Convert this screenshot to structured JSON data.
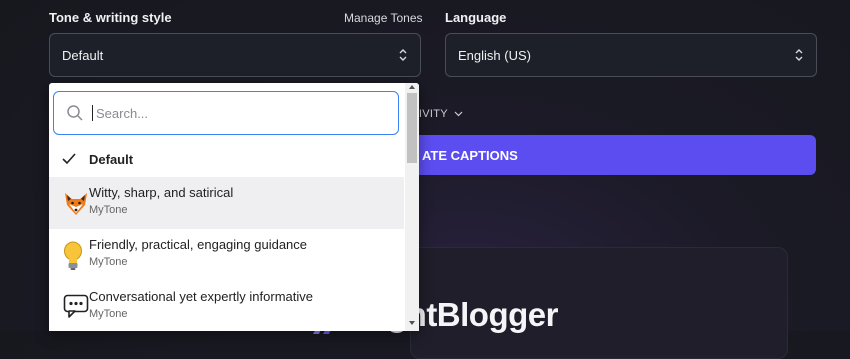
{
  "tone": {
    "label": "Tone & writing style",
    "manage_link": "Manage Tones",
    "selected": "Default"
  },
  "language": {
    "label": "Language",
    "selected": "English (US)"
  },
  "activity_label": "ATIVITY",
  "generate_button": "ATE CAPTIONS",
  "brand_text": "RightBlogger",
  "dropdown": {
    "search_placeholder": "Search...",
    "options": [
      {
        "title": "Default",
        "checked": true
      },
      {
        "title": "Witty, sharp, and satirical",
        "subtitle": "MyTone",
        "icon": "fox-icon"
      },
      {
        "title": "Friendly, practical, engaging guidance",
        "subtitle": "MyTone",
        "icon": "lightbulb-icon"
      },
      {
        "title": "Conversational yet expertly informative",
        "subtitle": "MyTone",
        "icon": "speech-bubble-icon"
      }
    ]
  },
  "colors": {
    "accent": "#5b4df0",
    "focus_border": "#3b82f6",
    "background": "#17181e"
  }
}
